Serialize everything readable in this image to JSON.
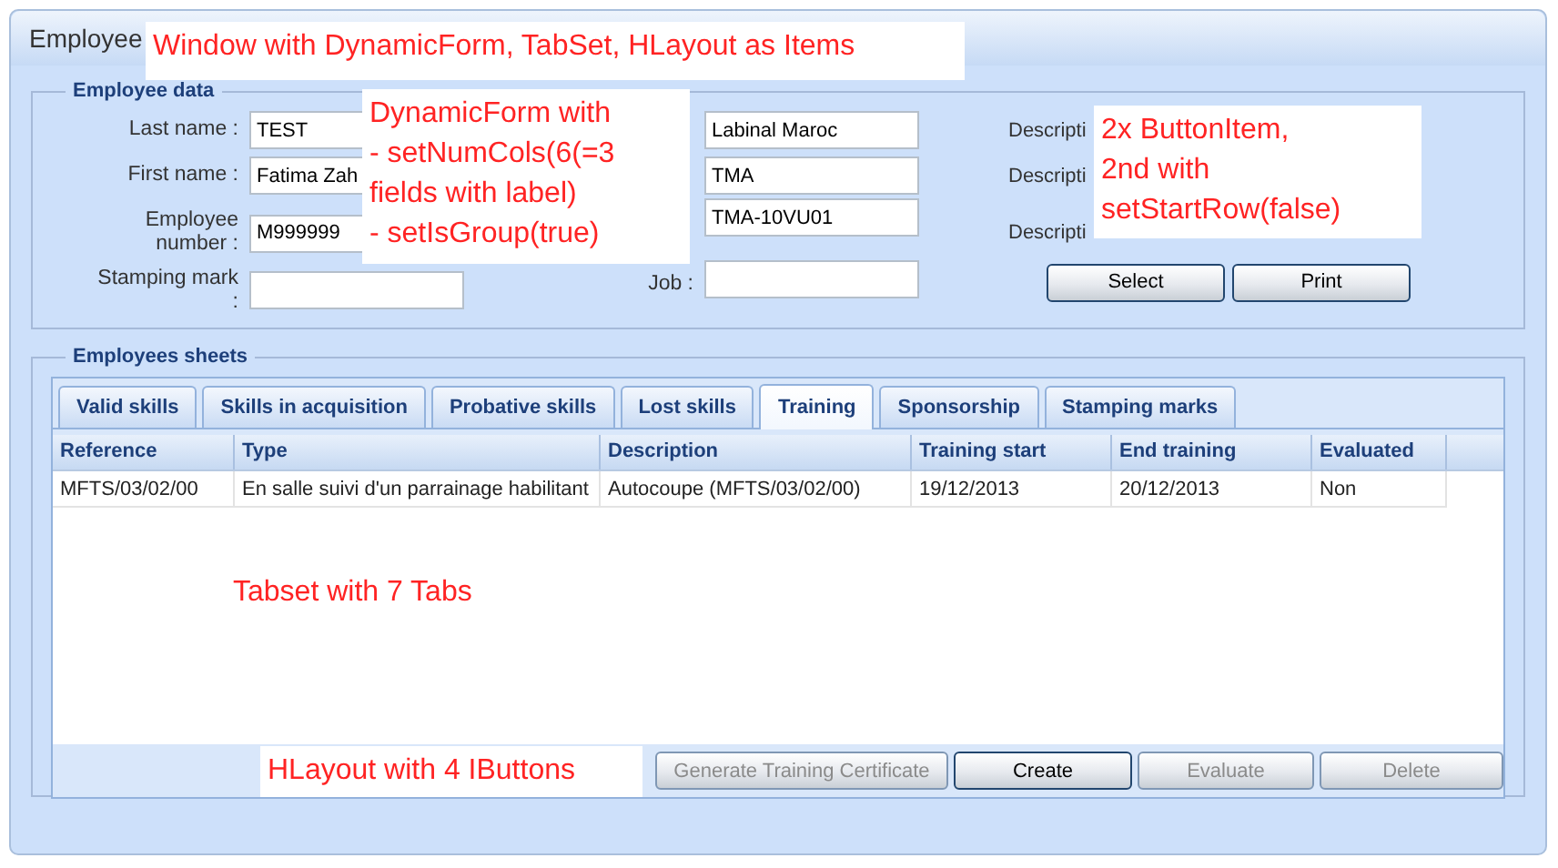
{
  "window": {
    "title": "Employee"
  },
  "employee_data": {
    "legend": "Employee data",
    "left_fields": [
      {
        "label": "Last name :",
        "value": "TEST"
      },
      {
        "label": "First name :",
        "value": "Fatima Zah"
      },
      {
        "label": "Employee number :",
        "value": "M999999"
      },
      {
        "label": "Stamping mark :"
      }
    ],
    "middle_fields": [
      {
        "value": "Labinal Maroc"
      },
      {
        "value": "TMA"
      },
      {
        "value": "TMA-10VU01"
      },
      {
        "label": "Job :"
      }
    ],
    "description_labels": [
      "Descripti",
      "Descripti",
      "Descripti"
    ],
    "buttons": [
      "Select",
      "Print"
    ]
  },
  "employees_sheets": {
    "legend": "Employees sheets",
    "tabs": [
      {
        "label": "Valid skills",
        "selected": false
      },
      {
        "label": "Skills in acquisition",
        "selected": false
      },
      {
        "label": "Probative skills",
        "selected": false
      },
      {
        "label": "Lost skills",
        "selected": false
      },
      {
        "label": "Training",
        "selected": true
      },
      {
        "label": "Sponsorship",
        "selected": false
      },
      {
        "label": "Stamping marks",
        "selected": false
      }
    ],
    "table": {
      "columns": [
        "Reference",
        "Type",
        "Description",
        "Training start",
        "End training",
        "Evaluated"
      ],
      "rows": [
        [
          "MFTS/03/02/00",
          "En salle suivi d'un parrainage habilitant",
          "Autocoupe (MFTS/03/02/00)",
          "19/12/2013",
          "20/12/2013",
          "Non"
        ]
      ]
    },
    "actions": [
      {
        "label": "Generate Training Certificate",
        "disabled": true
      },
      {
        "label": "Create",
        "disabled": false
      },
      {
        "label": "Evaluate",
        "disabled": true
      },
      {
        "label": "Delete",
        "disabled": true
      }
    ]
  },
  "annotations": [
    {
      "lines": [
        "Window with DynamicForm, TabSet, HLayout as Items"
      ]
    },
    {
      "lines": [
        "DynamicForm with",
        "- setNumCols(6(=3",
        "fields with label)",
        "- setIsGroup(true)"
      ]
    },
    {
      "lines": [
        "2x ButtonItem,",
        "2nd with",
        "setStartRow(false)"
      ]
    },
    {
      "lines": [
        "Tabset with 7 Tabs"
      ]
    },
    {
      "lines": [
        "HLayout with 4 IButtons"
      ]
    }
  ]
}
